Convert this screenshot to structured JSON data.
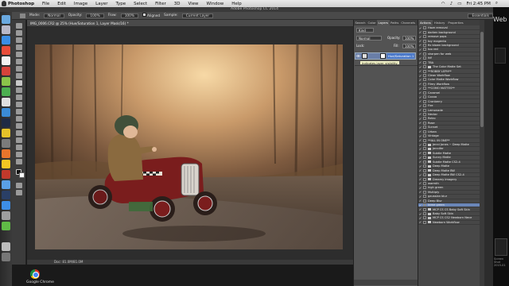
{
  "menubar": {
    "app": "Photoshop",
    "items": [
      "File",
      "Edit",
      "Image",
      "Layer",
      "Type",
      "Select",
      "Filter",
      "3D",
      "View",
      "Window",
      "Help"
    ],
    "clock": "Fri 2:45 PM"
  },
  "window_title": "Adobe Photoshop CC 2014",
  "options_bar": {
    "mode_label": "Mode:",
    "mode_value": "Normal",
    "opacity_label": "Opacity:",
    "opacity_value": "100%",
    "flow_label": "Flow:",
    "flow_value": "100%",
    "aligned_label": "Aligned",
    "sample_label": "Sample:",
    "sample_value": "Current Layer",
    "workspace": "Essentials"
  },
  "document": {
    "tab": "IMG_0006.CR2 @ 25% (Hue/Saturation 1, Layer Mask/16) *",
    "status": "Doc: 81.0M/81.0M"
  },
  "dock_bottom_label": "Google Chrome",
  "edge_label": "Web",
  "edge_small_text": "Screen Shot 2015-01",
  "layers_panel": {
    "tabs": [
      "Search",
      "Color",
      "Layers",
      "Paths",
      "Channels"
    ],
    "active_tab": "Layers",
    "filter_value": "Kind",
    "blend_value": "Normal",
    "opacity_label": "Opacity:",
    "opacity_value": "100%",
    "lock_label": "Lock:",
    "fill_label": "Fill:",
    "fill_value": "100%",
    "layer_name": "Hue/Saturation 1",
    "tooltip": "Indicates layer visibility"
  },
  "actions_panel": {
    "tabs": [
      "Actions",
      "History",
      "Properties"
    ],
    "active_tab": "Actions",
    "items": [
      {
        "label": "Haze removal",
        "kind": "item"
      },
      {
        "label": "darken background",
        "kind": "item"
      },
      {
        "label": "remove pops",
        "kind": "item"
      },
      {
        "label": "toy magenta",
        "kind": "item"
      },
      {
        "label": "fix blown background",
        "kind": "item"
      },
      {
        "label": "too red",
        "kind": "item"
      },
      {
        "label": "sharpen for web",
        "kind": "item"
      },
      {
        "label": "fdf",
        "kind": "item"
      },
      {
        "label": "TBA",
        "kind": "item"
      },
      {
        "label": "The Color Matte Set",
        "kind": "set"
      },
      {
        "label": "**ROBBY LEPH**",
        "kind": "item"
      },
      {
        "label": "Clean Workflow",
        "kind": "item"
      },
      {
        "label": "Color Matte Workflow",
        "kind": "item"
      },
      {
        "label": "Filmy Workflow",
        "kind": "item"
      },
      {
        "label": "**COMO MATTES**",
        "kind": "item"
      },
      {
        "label": "Caramel",
        "kind": "item"
      },
      {
        "label": "Cocoa",
        "kind": "item"
      },
      {
        "label": "Cranberry",
        "kind": "item"
      },
      {
        "label": "Fire",
        "kind": "item"
      },
      {
        "label": "Lemonade",
        "kind": "item"
      },
      {
        "label": "Nectar",
        "kind": "item"
      },
      {
        "label": "Retro",
        "kind": "item"
      },
      {
        "label": "Rose",
        "kind": "item"
      },
      {
        "label": "Sunset",
        "kind": "item"
      },
      {
        "label": "Urban",
        "kind": "item"
      },
      {
        "label": "Vintage",
        "kind": "item"
      },
      {
        "label": "**ALL IN ONE**",
        "kind": "item"
      },
      {
        "label": "Jenni Jones ~ Deep Matte",
        "kind": "set"
      },
      {
        "label": "Jennifer",
        "kind": "set"
      },
      {
        "label": "Subtle Matte",
        "kind": "set"
      },
      {
        "label": "Sunny Matte",
        "kind": "set"
      },
      {
        "label": "Subtle Matte CS2-4",
        "kind": "set"
      },
      {
        "label": "Deep Matte",
        "kind": "set"
      },
      {
        "label": "Deep Matte BW",
        "kind": "set"
      },
      {
        "label": "Deep Matte BW CS2-4",
        "kind": "set"
      },
      {
        "label": "Dreamy Imagery",
        "kind": "set"
      },
      {
        "label": "warmth",
        "kind": "item"
      },
      {
        "label": "high green",
        "kind": "item"
      },
      {
        "label": "Multiply",
        "kind": "item"
      },
      {
        "label": "gaussian blur",
        "kind": "item"
      },
      {
        "label": "Deep Blur",
        "kind": "item"
      },
      {
        "label": "tame green",
        "kind": "item",
        "selected": true
      },
      {
        "label": "MCP CS CS Baby Soft Skin",
        "kind": "set"
      },
      {
        "label": "Baby Soft Skin",
        "kind": "set"
      },
      {
        "label": "MCP CS CS2 Newborn Nece",
        "kind": "set"
      },
      {
        "label": "Newborn Workflow",
        "kind": "set"
      }
    ]
  }
}
